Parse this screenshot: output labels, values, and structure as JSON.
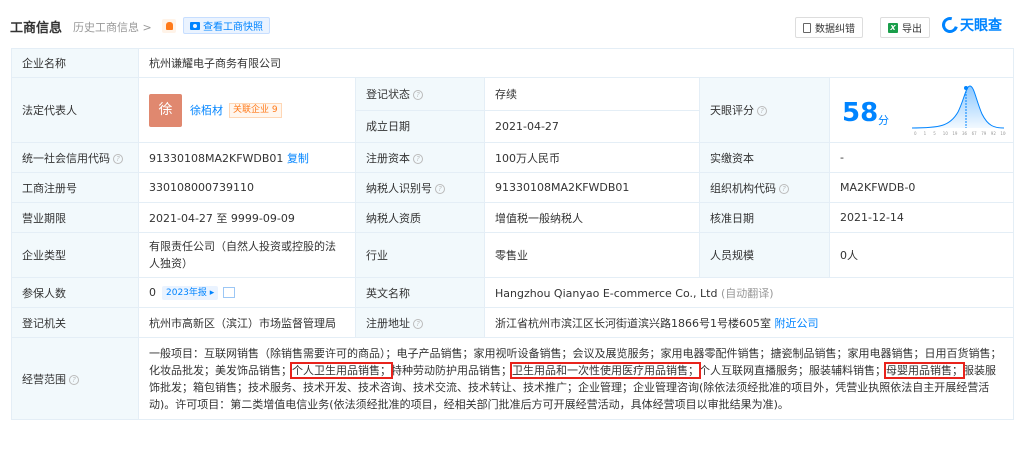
{
  "header": {
    "title": "工商信息",
    "history": "历史工商信息",
    "history_chevron": ">",
    "snapshot": "查看工商快照",
    "report_btn": "数据纠错",
    "export_btn": "导出",
    "logo": "天眼查"
  },
  "fields": {
    "company_name_label": "企业名称",
    "company_name": "杭州谦耀电子商务有限公司",
    "legal_rep_label": "法定代表人",
    "legal_rep_avatar": "徐",
    "legal_rep_name": "徐栢材",
    "legal_rep_assoc": "关联企业 9",
    "reg_status_label": "登记状态",
    "reg_status": "存续",
    "founded_label": "成立日期",
    "founded": "2021-04-27",
    "score_label": "天眼评分",
    "score": "58",
    "score_unit": "分",
    "credit_code_label": "统一社会信用代码",
    "credit_code": "91330108MA2KFWDB01",
    "copy": "复制",
    "reg_capital_label": "注册资本",
    "reg_capital": "100万人民币",
    "paid_capital_label": "实缴资本",
    "paid_capital": "-",
    "biz_reg_no_label": "工商注册号",
    "biz_reg_no": "330108000739110",
    "taxpayer_id_label": "纳税人识别号",
    "taxpayer_id": "91330108MA2KFWDB01",
    "org_code_label": "组织机构代码",
    "org_code": "MA2KFWDB-0",
    "biz_term_label": "营业期限",
    "biz_term": "2021-04-27 至 9999-09-09",
    "taxpayer_qual_label": "纳税人资质",
    "taxpayer_qual": "增值税一般纳税人",
    "approval_date_label": "核准日期",
    "approval_date": "2021-12-14",
    "company_type_label": "企业类型",
    "company_type": "有限责任公司（自然人投资或控股的法人独资）",
    "industry_label": "行业",
    "industry": "零售业",
    "staff_size_label": "人员规模",
    "staff_size": "0人",
    "insured_label": "参保人数",
    "insured": "0",
    "insured_report": "2023年报",
    "english_name_label": "英文名称",
    "english_name": "Hangzhou Qianyao E-commerce Co., Ltd",
    "english_name_note": "(自动翻译)",
    "reg_authority_label": "登记机关",
    "reg_authority": "杭州市高新区（滨江）市场监督管理局",
    "reg_address_label": "注册地址",
    "reg_address": "浙江省杭州市滨江区长河街道滨兴路1866号1号楼605室",
    "nearby": "附近公司",
    "scope_label": "经营范围",
    "scope_1": "一般项目：互联网销售（除销售需要许可的商品）；电子产品销售；家用视听设备销售；会议及展览服务；家用电器零配件销售；搪瓷制品销售；家用电器销售；日用百货销售；化妆品批发；美发饰品销售；",
    "scope_hl1": "个人卫生用品销售；",
    "scope_2": "特种劳动防护用品销售；",
    "scope_hl2": "卫生用品和一次性使用医疗用品销售；",
    "scope_3": "个人互联网直播服务；服装辅料销售；",
    "scope_hl3": "母婴用品销售；",
    "scope_4": "服装服饰批发；箱包销售；技术服务、技术开发、技术咨询、技术交流、技术转让、技术推广；企业管理；企业管理咨询(除依法须经批准的项目外，凭营业执照依法自主开展经营活动)。许可项目：第二类增值电信业务(依法须经批准的项目，经相关部门批准后方可开展经营活动，具体经营项目以审批结果为准)。"
  },
  "score_chart_ticks": [
    "0",
    "1",
    "5",
    "10",
    "19",
    "36",
    "67",
    "79",
    "92",
    "100"
  ],
  "colors": {
    "brand": "#0084ff",
    "label_bg": "#f2f9fc",
    "highlight": "#e8231c",
    "status_green": "#1aad19"
  }
}
